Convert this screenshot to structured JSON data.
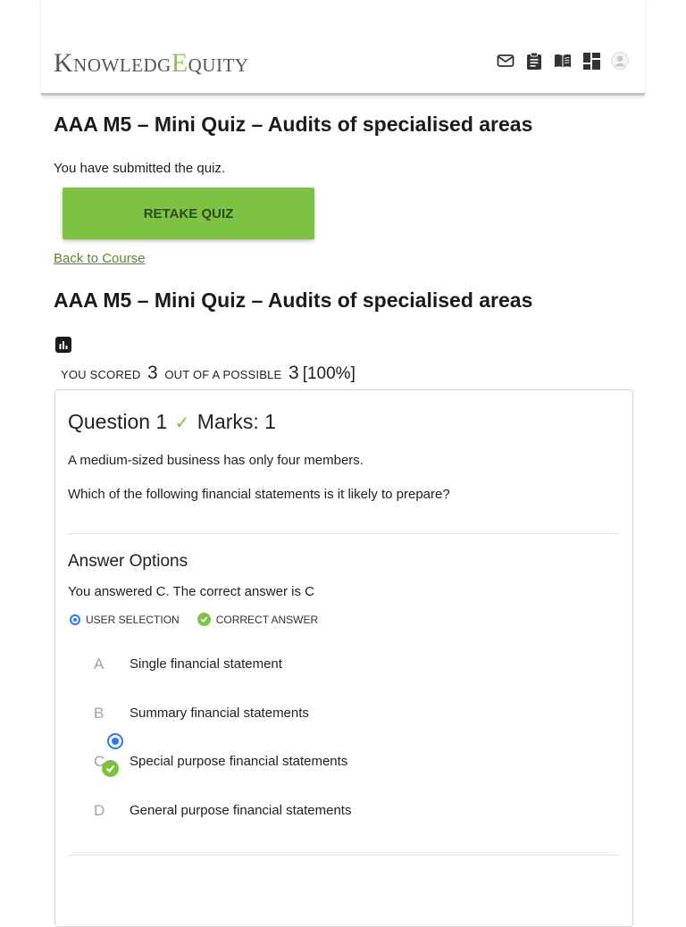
{
  "header": {
    "logo": {
      "part1": "Knowledg",
      "part2": "E",
      "part3": "quity"
    },
    "icons": [
      "mail-icon",
      "clipboard-icon",
      "book-icon",
      "dashboard-icon",
      "user-avatar-icon"
    ]
  },
  "quiz": {
    "title": "AAA M5 – Mini Quiz – Audits of specialised areas",
    "submitted_message": "You have submitted the quiz.",
    "retake_label": "RETAKE QUIZ",
    "back_link": "Back to Course",
    "results_title": "AAA M5 – Mini Quiz – Audits of specialised areas",
    "score": {
      "prefix": "You scored",
      "value": "3",
      "middle": "out of a possible",
      "total": "3",
      "percent": "[100%]"
    }
  },
  "question": {
    "title": "Question 1",
    "marks": "Marks: 1",
    "text1": "A medium-sized business has only four members.",
    "text2": "Which of the following financial statements is it likely to prepare?",
    "answer_options_title": "Answer Options",
    "summary": "You answered C. The correct answer is C",
    "legend": {
      "user_selection": "USER SELECTION",
      "correct_answer": "CORRECT ANSWER"
    },
    "options": [
      {
        "letter": "A",
        "text": "Single financial statement"
      },
      {
        "letter": "B",
        "text": "Summary financial statements"
      },
      {
        "letter": "C",
        "text": "Special purpose financial statements",
        "selected": true,
        "correct": true
      },
      {
        "letter": "D",
        "text": "General purpose financial statements"
      }
    ]
  },
  "colors": {
    "accent_green": "#7dc242",
    "selection_blue": "#2979ff",
    "link_green": "#5a8a28"
  }
}
